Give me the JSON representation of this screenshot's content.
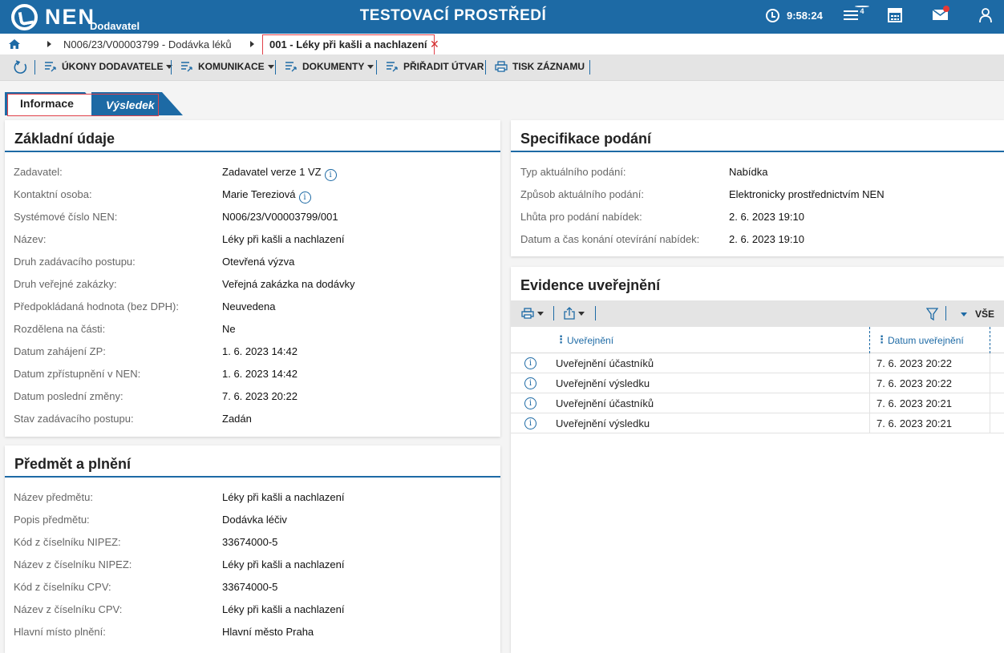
{
  "header": {
    "logo_text": "NEN",
    "logo_sub": "Dodavatel",
    "env_title": "TESTOVACÍ PROSTŘEDÍ",
    "clock": "9:58:24",
    "menu_badge": "4"
  },
  "breadcrumb": {
    "item1": "N006/23/V00003799 - Dodávka léků",
    "active": "001 - Léky při kašli a nachlazení"
  },
  "toolbar": {
    "ukony": "ÚKONY DODAVATELE",
    "komunikace": "KOMUNIKACE",
    "dokumenty": "DOKUMENTY",
    "priradit": "PŘIŘADIT ÚTVAR",
    "tisk": "TISK ZÁZNAMU"
  },
  "tabs": {
    "informace": "Informace",
    "vysledek": "Výsledek"
  },
  "zakladni": {
    "title": "Základní údaje",
    "rows": [
      {
        "label": "Zadavatel:",
        "value": "Zadavatel verze 1 VZ"
      },
      {
        "label": "Kontaktní osoba:",
        "value": "Marie  Tereziová"
      },
      {
        "label": "Systémové číslo NEN:",
        "value": "N006/23/V00003799/001"
      },
      {
        "label": "Název:",
        "value": "Léky při kašli a nachlazení"
      },
      {
        "label": "Druh zadávacího postupu:",
        "value": "Otevřená výzva"
      },
      {
        "label": "Druh veřejné zakázky:",
        "value": "Veřejná zakázka na dodávky"
      },
      {
        "label": "Předpokládaná hodnota (bez DPH):",
        "value": "Neuvedena"
      },
      {
        "label": "Rozdělena na části:",
        "value": "Ne"
      },
      {
        "label": "Datum zahájení ZP:",
        "value": "1. 6. 2023 14:42"
      },
      {
        "label": "Datum zpřístupnění v NEN:",
        "value": "1. 6. 2023 14:42"
      },
      {
        "label": "Datum poslední změny:",
        "value": "7. 6. 2023 20:22"
      },
      {
        "label": "Stav zadávacího postupu:",
        "value": "Zadán"
      }
    ]
  },
  "predmet": {
    "title": "Předmět a plnění",
    "rows": [
      {
        "label": "Název předmětu:",
        "value": "Léky při kašli a nachlazení"
      },
      {
        "label": "Popis předmětu:",
        "value": "Dodávka léčiv"
      },
      {
        "label": "Kód z číselníku NIPEZ:",
        "value": "33674000-5"
      },
      {
        "label": "Název z číselníku NIPEZ:",
        "value": "Léky při kašli a nachlazení"
      },
      {
        "label": "Kód z číselníku CPV:",
        "value": "33674000-5"
      },
      {
        "label": "Název z číselníku CPV:",
        "value": "Léky při kašli a nachlazení"
      },
      {
        "label": "Hlavní místo plnění:",
        "value": "Hlavní město Praha"
      }
    ]
  },
  "specifikace": {
    "title": "Specifikace podání",
    "rows": [
      {
        "label": "Typ aktuálního podání:",
        "value": "Nabídka"
      },
      {
        "label": "Způsob aktuálního podání:",
        "value": "Elektronicky prostřednictvím NEN"
      },
      {
        "label": "Lhůta pro podání nabídek:",
        "value": "2. 6. 2023 19:10"
      },
      {
        "label": "Datum a čas konání otevírání nabídek:",
        "value": "2. 6. 2023 19:10"
      }
    ]
  },
  "evidence": {
    "title": "Evidence uveřejnění",
    "filter_all": "VŠE",
    "col1": "Uveřejnění",
    "col2": "Datum uveřejnění",
    "rows": [
      {
        "name": "Uveřejnění účastníků",
        "date": "7. 6. 2023 20:22"
      },
      {
        "name": "Uveřejnění výsledku",
        "date": "7. 6. 2023 20:22"
      },
      {
        "name": "Uveřejnění účastníků",
        "date": "7. 6. 2023 20:21"
      },
      {
        "name": "Uveřejnění výsledku",
        "date": "7. 6. 2023 20:21"
      }
    ]
  }
}
